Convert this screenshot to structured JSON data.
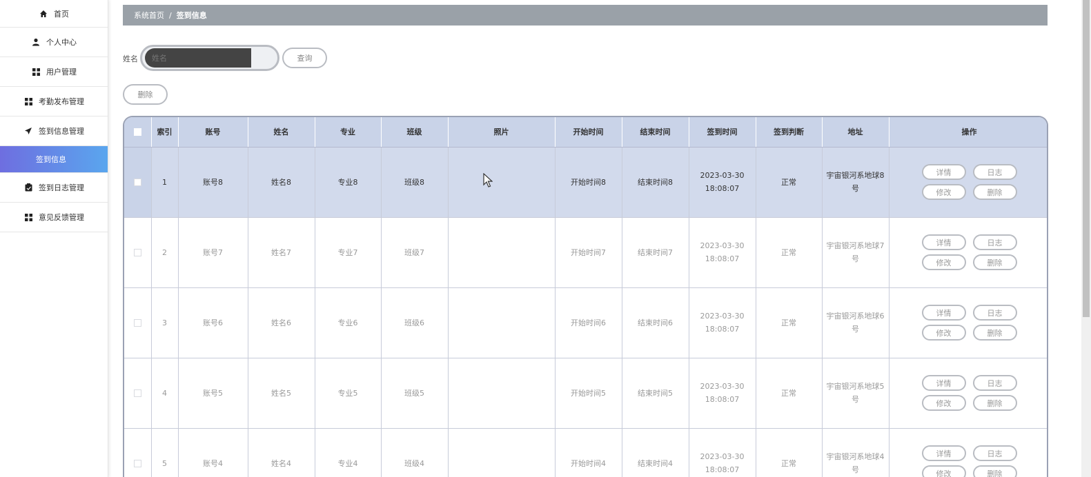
{
  "sidebar": {
    "items": [
      {
        "label": "首页",
        "icon": "home-icon"
      },
      {
        "label": "个人中心",
        "icon": "user-icon"
      },
      {
        "label": "用户管理",
        "icon": "grid-icon"
      },
      {
        "label": "考勤发布管理",
        "icon": "grid-icon"
      },
      {
        "label": "签到信息管理",
        "icon": "send-icon"
      },
      {
        "label": "签到信息",
        "icon": ""
      },
      {
        "label": "签到日志管理",
        "icon": "clipboard-icon"
      },
      {
        "label": "意见反馈管理",
        "icon": "grid-icon"
      }
    ],
    "active_color_start": "#6e6ee0",
    "active_color_end": "#5aa6ee"
  },
  "breadcrumb": {
    "home": "系统首页",
    "separator": "/",
    "current": "签到信息"
  },
  "search": {
    "label": "姓名",
    "placeholder": "姓名",
    "query_button": "查询"
  },
  "toolbar": {
    "delete_button": "删除"
  },
  "table": {
    "headers": [
      "索引",
      "账号",
      "姓名",
      "专业",
      "班级",
      "照片",
      "开始时间",
      "结束时间",
      "签到时间",
      "签到判断",
      "地址",
      "操作"
    ],
    "rows": [
      {
        "index": "1",
        "account": "账号8",
        "name": "姓名8",
        "major": "专业8",
        "class": "班级8",
        "start": "开始时间8",
        "end": "结束时间8",
        "checkin_time": "2023-03-30 18:08:07",
        "judge": "正常",
        "address": "宇宙银河系地球8号"
      },
      {
        "index": "2",
        "account": "账号7",
        "name": "姓名7",
        "major": "专业7",
        "class": "班级7",
        "start": "开始时间7",
        "end": "结束时间7",
        "checkin_time": "2023-03-30 18:08:07",
        "judge": "正常",
        "address": "宇宙银河系地球7号"
      },
      {
        "index": "3",
        "account": "账号6",
        "name": "姓名6",
        "major": "专业6",
        "class": "班级6",
        "start": "开始时间6",
        "end": "结束时间6",
        "checkin_time": "2023-03-30 18:08:07",
        "judge": "正常",
        "address": "宇宙银河系地球6号"
      },
      {
        "index": "4",
        "account": "账号5",
        "name": "姓名5",
        "major": "专业5",
        "class": "班级5",
        "start": "开始时间5",
        "end": "结束时间5",
        "checkin_time": "2023-03-30 18:08:07",
        "judge": "正常",
        "address": "宇宙银河系地球5号"
      },
      {
        "index": "5",
        "account": "账号4",
        "name": "姓名4",
        "major": "专业4",
        "class": "班级4",
        "start": "开始时间4",
        "end": "结束时间4",
        "checkin_time": "2023-03-30 18:08:07",
        "judge": "正常",
        "address": "宇宙银河系地球4号"
      }
    ],
    "actions": {
      "detail": "详情",
      "log": "日志",
      "edit": "修改",
      "delete": "删除"
    },
    "header_bg": "#c9d3e8",
    "selected_row_bg": "#d2daec"
  }
}
